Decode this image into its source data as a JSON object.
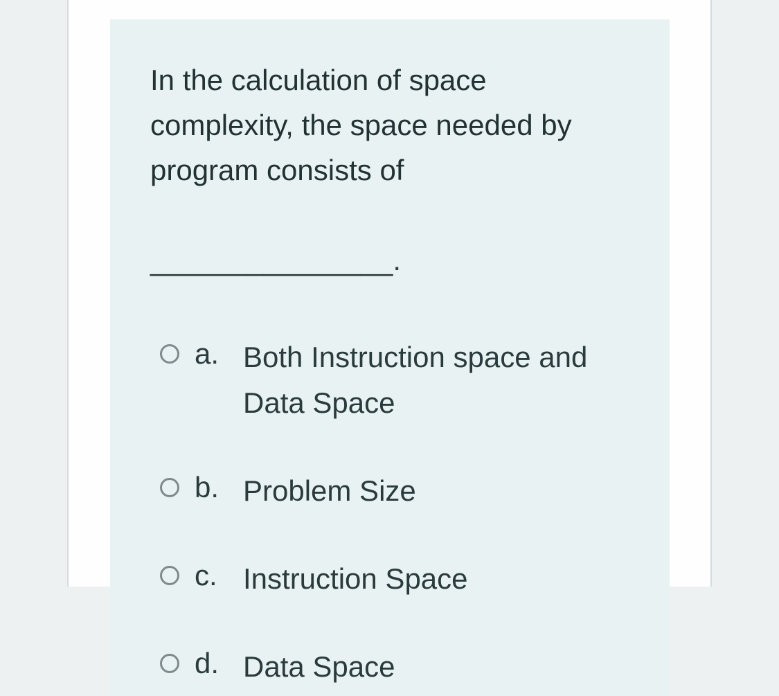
{
  "question": {
    "text": "In the calculation of space complexity, the space needed by program consists of",
    "blank": "_______________."
  },
  "options": [
    {
      "letter": "a.",
      "text": "Both Instruction space and Data Space",
      "selected": false
    },
    {
      "letter": "b.",
      "text": "Problem Size",
      "selected": false
    },
    {
      "letter": "c.",
      "text": "Instruction Space",
      "selected": false
    },
    {
      "letter": "d.",
      "text": "Data Space",
      "selected": false
    }
  ]
}
